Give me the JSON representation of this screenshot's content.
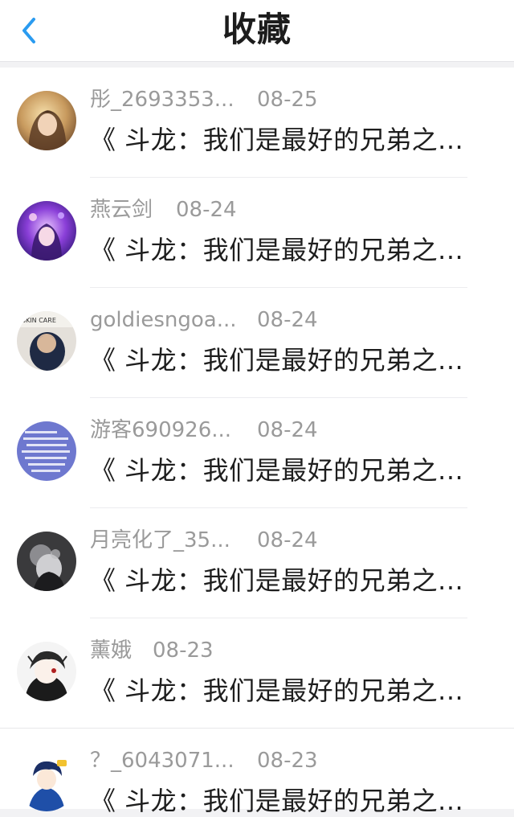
{
  "header": {
    "title": "收藏"
  },
  "items": [
    {
      "name": "彤_2693353...",
      "date": "08-25",
      "content": "《 斗龙：我们是最好的兄弟之...",
      "avatar_icon": "avatar-girl-warm"
    },
    {
      "name": "燕云剑",
      "date": "08-24",
      "content": "《 斗龙：我们是最好的兄弟之...",
      "avatar_icon": "avatar-anime-purple"
    },
    {
      "name": "goldiesngoa...",
      "date": "08-24",
      "content": "《 斗龙：我们是最好的兄弟之...",
      "avatar_icon": "avatar-skin-care"
    },
    {
      "name": "游客690926...",
      "date": "08-24",
      "content": "《 斗龙：我们是最好的兄弟之...",
      "avatar_icon": "avatar-text-blue"
    },
    {
      "name": "月亮化了_35...",
      "date": "08-24",
      "content": "《 斗龙：我们是最好的兄弟之...",
      "avatar_icon": "avatar-dark-monochrome"
    },
    {
      "name": "薰娥",
      "date": "08-23",
      "content": "《 斗龙：我们是最好的兄弟之...",
      "avatar_icon": "avatar-anime-boy"
    },
    {
      "name": "？_6043071...",
      "date": "08-23",
      "content": "《 斗龙：我们是最好的兄弟之...",
      "avatar_icon": "avatar-blue-character"
    }
  ]
}
